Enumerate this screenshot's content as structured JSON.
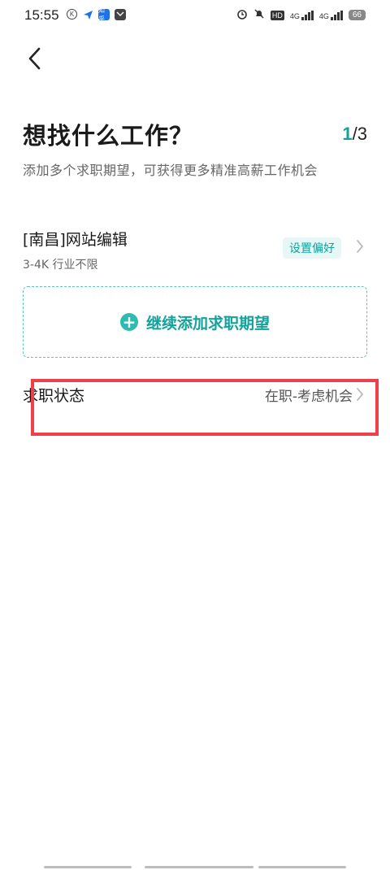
{
  "status_bar": {
    "time": "15:55",
    "left_icons": [
      "k-icon",
      "paper-plane-icon",
      "zhihu-icon",
      "mail-icon"
    ],
    "zhihu_label": "知乎",
    "hd_label": "HD",
    "network_label_1": "4G",
    "network_label_2": "4G",
    "battery": "66"
  },
  "header": {
    "title": "想找什么工作？",
    "step_current": "1",
    "step_total": "/3",
    "subtitle": "添加多个求职期望，可获得更多精准高薪工作机会"
  },
  "expectation": {
    "title": "[南昌]网站编辑",
    "detail": "3-4K 行业不限",
    "preference_label": "设置偏好"
  },
  "add_button": {
    "label": "继续添加求职期望"
  },
  "job_status": {
    "label": "求职状态",
    "value": "在职-考虑机会"
  },
  "colors": {
    "accent": "#13a29c",
    "accent_light": "#e6f7f5",
    "highlight": "#ee3f4a"
  }
}
